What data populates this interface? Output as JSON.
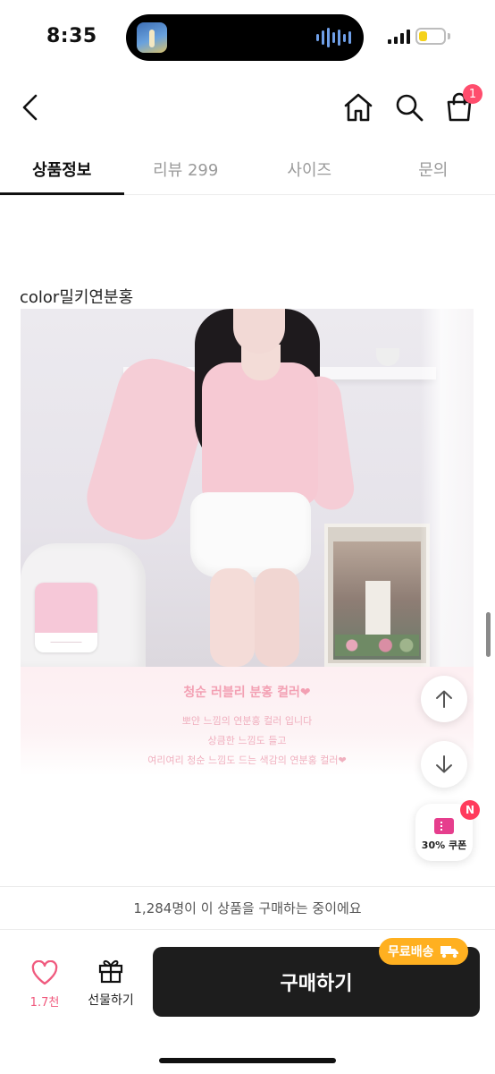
{
  "status": {
    "time": "8:35",
    "battery_level": 0.35
  },
  "nav": {
    "back_icon": "chevron-left-icon",
    "home_icon": "home-icon",
    "search_icon": "search-icon",
    "cart_icon": "shopping-bag-icon",
    "cart_badge": "1"
  },
  "tabs": [
    {
      "label": "상품정보",
      "active": true
    },
    {
      "label": "리뷰 299",
      "active": false
    },
    {
      "label": "사이즈",
      "active": false
    },
    {
      "label": "문의",
      "active": false
    }
  ],
  "content": {
    "color_label": "color밀키연분홍",
    "swatch_color": "#f6c8d8"
  },
  "promo": {
    "title": "청순 러블리 분홍 컬러❤",
    "line1": "뽀얀 느낌의 연분홍 컬러 입니다",
    "line2": "상큼한 느낌도 들고",
    "line3": "여리여리 청순 느낌도 드는 색감의 연분홍 컬러❤"
  },
  "floating": {
    "scroll_up_icon": "arrow-up-icon",
    "scroll_down_icon": "arrow-down-icon",
    "coupon_badge": "N",
    "coupon_label": "30% 쿠폰"
  },
  "bottom": {
    "notice": "1,284명이 이 상품을 구매하는 중이에요",
    "like_count": "1.7천",
    "gift_label": "선물하기",
    "buy_label": "구매하기",
    "free_shipping": "무료배송"
  },
  "colors": {
    "accent_pink": "#f05a7e",
    "badge_red": "#ff4d6d",
    "buy_button": "#1d1d1d",
    "free_shipping": "#ffb020"
  }
}
